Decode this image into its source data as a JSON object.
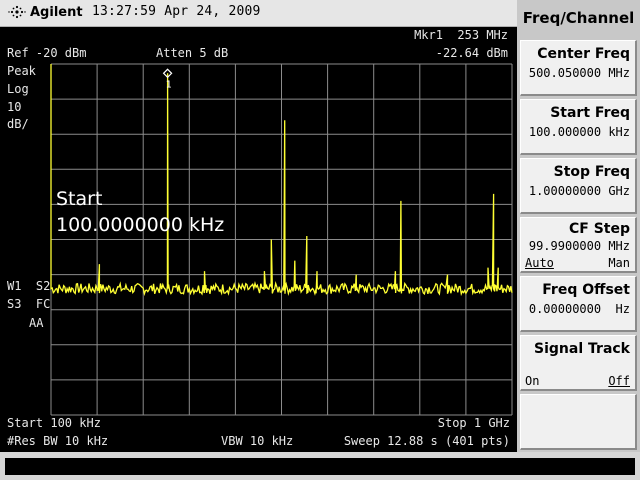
{
  "header": {
    "brand": "Agilent",
    "datetime": "13:27:59  Apr 24, 2009"
  },
  "screen": {
    "ref": "Ref -20 dBm",
    "atten": "Atten 5 dB",
    "marker": "Mkr1  253 MHz",
    "marker_level": "-22.64 dBm",
    "detector": [
      "Peak",
      "Log",
      "10",
      "dB/"
    ],
    "side_labels": [
      "W1  S2",
      "S3  FC",
      "AA"
    ],
    "active_function": {
      "title": "Start",
      "value": "100.0000000 kHz"
    },
    "start": "Start 100 kHz",
    "stop": "Stop 1 GHz",
    "res_bw": "#Res BW 10 kHz",
    "vbw": "VBW 10 kHz",
    "sweep": "Sweep 12.88 s (401 pts)",
    "marker_label": "1",
    "trace_color": "#ffff33",
    "grid_color": "#8c8c8c"
  },
  "softkeys": {
    "menu_title": "Freq/Channel",
    "keys": [
      {
        "label": "Center Freq",
        "value": "500.050000 MHz"
      },
      {
        "label": "Start Freq",
        "value": "100.000000 kHz"
      },
      {
        "label": "Stop Freq",
        "value": "1.00000000 GHz"
      },
      {
        "label": "CF Step",
        "value": "99.9900000 MHz",
        "opt_left": "Auto",
        "opt_right": "Man"
      },
      {
        "label": "Freq Offset",
        "value": "0.00000000  Hz"
      },
      {
        "label": "Signal Track",
        "opt_left": "On",
        "opt_right": "Off"
      }
    ]
  },
  "chart_data": {
    "type": "line",
    "x_units": "MHz",
    "y_units": "dBm",
    "xlim": [
      0.1,
      1000
    ],
    "ylim": [
      -120,
      -20
    ],
    "noise_floor_dbm": -84,
    "peaks": [
      {
        "x": 100,
        "y": -84
      },
      {
        "x": 105,
        "y": -77
      },
      {
        "x": 110,
        "y": -84
      },
      {
        "x": 252,
        "y": -84
      },
      {
        "x": 253,
        "y": -22.64
      },
      {
        "x": 254,
        "y": -84
      },
      {
        "x": 330,
        "y": -83
      },
      {
        "x": 333,
        "y": -79
      },
      {
        "x": 336,
        "y": -83
      },
      {
        "x": 460,
        "y": -84
      },
      {
        "x": 463,
        "y": -79
      },
      {
        "x": 466,
        "y": -84
      },
      {
        "x": 476,
        "y": -83
      },
      {
        "x": 478,
        "y": -70
      },
      {
        "x": 480,
        "y": -83
      },
      {
        "x": 505,
        "y": -83
      },
      {
        "x": 507,
        "y": -36
      },
      {
        "x": 509,
        "y": -83
      },
      {
        "x": 526,
        "y": -84
      },
      {
        "x": 529,
        "y": -76
      },
      {
        "x": 532,
        "y": -84
      },
      {
        "x": 552,
        "y": -83
      },
      {
        "x": 555,
        "y": -69
      },
      {
        "x": 558,
        "y": -83
      },
      {
        "x": 575,
        "y": -84
      },
      {
        "x": 577,
        "y": -79
      },
      {
        "x": 579,
        "y": -84
      },
      {
        "x": 660,
        "y": -84
      },
      {
        "x": 662,
        "y": -80
      },
      {
        "x": 664,
        "y": -84
      },
      {
        "x": 745,
        "y": -83
      },
      {
        "x": 747,
        "y": -79
      },
      {
        "x": 749,
        "y": -83
      },
      {
        "x": 757,
        "y": -84
      },
      {
        "x": 759,
        "y": -59
      },
      {
        "x": 761,
        "y": -84
      },
      {
        "x": 857,
        "y": -83
      },
      {
        "x": 860,
        "y": -80
      },
      {
        "x": 863,
        "y": -83
      },
      {
        "x": 945,
        "y": -84
      },
      {
        "x": 948,
        "y": -78
      },
      {
        "x": 951,
        "y": -84
      },
      {
        "x": 957,
        "y": -83
      },
      {
        "x": 960,
        "y": -57
      },
      {
        "x": 963,
        "y": -83
      },
      {
        "x": 968,
        "y": -84
      },
      {
        "x": 970,
        "y": -78
      },
      {
        "x": 972,
        "y": -84
      }
    ],
    "marker": {
      "x": 253,
      "y": -22.64,
      "label": "1"
    }
  }
}
